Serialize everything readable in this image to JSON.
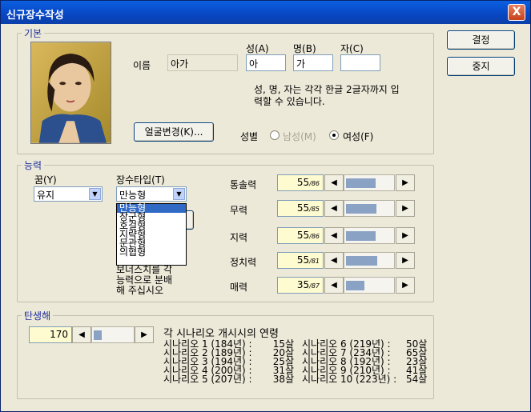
{
  "window": {
    "title": "신규장수작성",
    "close": "X"
  },
  "buttons": {
    "confirm": "결정",
    "cancel": "중지",
    "face_change": "얼굴변경(K)..."
  },
  "basic": {
    "group_label": "기본",
    "name_label": "이름",
    "name_value": "아가",
    "surname_label": "성(A)",
    "surname_value": "아",
    "given_label": "명(B)",
    "given_value": "가",
    "style_label": "자(C)",
    "style_value": "",
    "hint_line1": "성, 명, 자는 각각 한글 2글자까지 입",
    "hint_line2": "력할 수 있습니다.",
    "gender_label": "성별",
    "gender_male": "남성(M)",
    "gender_female": "여성(F)",
    "gender_selected": "female"
  },
  "ability": {
    "group_label": "능력",
    "dream_label": "꿈(Y)",
    "dream_value": "유지",
    "type_label": "장수타입(T)",
    "type_value": "만능형",
    "type_options": [
      "만능형",
      "장군형",
      "호걸형",
      "지략형",
      "문관형",
      "의협형"
    ],
    "hidden_text_1": "보너스치를 각",
    "hidden_text_2": "능력으로 분배",
    "hidden_text_3": "해 주십시오",
    "stats": [
      {
        "label": "통솔력",
        "value": "55",
        "max": "/86",
        "fill": 0.64
      },
      {
        "label": "무력",
        "value": "55",
        "max": "/85",
        "fill": 0.65
      },
      {
        "label": "지력",
        "value": "55",
        "max": "/86",
        "fill": 0.64
      },
      {
        "label": "정치력",
        "value": "55",
        "max": "/81",
        "fill": 0.68
      },
      {
        "label": "매력",
        "value": "35",
        "max": "/87",
        "fill": 0.4
      }
    ],
    "arrow_left": "◀",
    "arrow_right": "▶"
  },
  "birth": {
    "group_label": "탄생해",
    "value": "170",
    "fill": 0.2,
    "caption": "각 시나리오 개시시의 연령",
    "scenarios": [
      {
        "l_name": "시나리오 1 (184년) :",
        "l_age": "15살",
        "r_name": "시나리오 6 (219년) :",
        "r_age": "50살"
      },
      {
        "l_name": "시나리오 2 (189년) :",
        "l_age": "20살",
        "r_name": "시나리오 7 (234년) :",
        "r_age": "65살"
      },
      {
        "l_name": "시나리오 3 (194년) :",
        "l_age": "25살",
        "r_name": "시나리오 8 (192년) :",
        "r_age": "23살"
      },
      {
        "l_name": "시나리오 4 (200년) :",
        "l_age": "31살",
        "r_name": "시나리오 9 (210년) :",
        "r_age": "41살"
      },
      {
        "l_name": "시나리오 5 (207년) :",
        "l_age": "38살",
        "r_name": "시나리오 10 (223년) :",
        "r_age": "54살"
      }
    ]
  },
  "colors": {
    "title_bar": "#0846c2",
    "group_label": "#1f2f9f",
    "selection": "#316ac5",
    "number_field": "#fffbd0",
    "bar_fill": "#8aa3c4"
  }
}
